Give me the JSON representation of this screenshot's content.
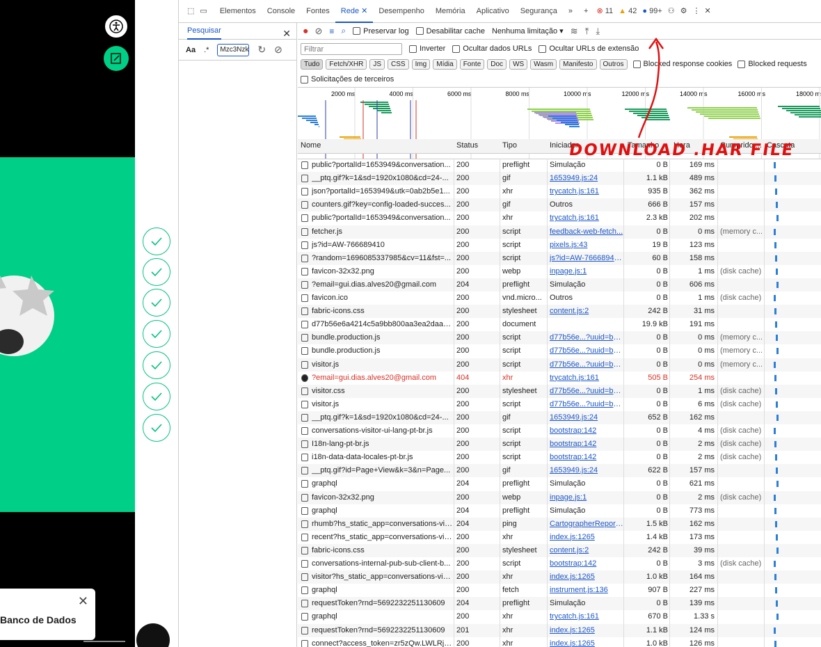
{
  "website": {
    "toast_text": "Banco de Dados"
  },
  "devtools": {
    "tabs": [
      "Elementos",
      "Console",
      "Fontes",
      "Rede",
      "Desempenho",
      "Memória",
      "Aplicativo",
      "Segurança"
    ],
    "badges": {
      "errors": "11",
      "warnings": "42",
      "info": "99+"
    },
    "search_panel": {
      "title": "Pesquisar",
      "case_label": "Aa",
      "regex_label": ".*",
      "query": "Mzc3Nzk"
    },
    "network_toolbar": {
      "preserve_log": "Preservar log",
      "disable_cache": "Desabilitar cache",
      "throttle": "Nenhuma limitação"
    },
    "filter": {
      "placeholder": "Filtrar",
      "invert": "Inverter",
      "hide_data_urls": "Ocultar dados URLs",
      "hide_ext_urls": "Ocultar URLs de extensão"
    },
    "type_filters": [
      "Tudo",
      "Fetch/XHR",
      "JS",
      "CSS",
      "Img",
      "Mídia",
      "Fonte",
      "Doc",
      "WS",
      "Wasm",
      "Manifesto",
      "Outros"
    ],
    "blocked_cookies": "Blocked response cookies",
    "blocked_requests": "Blocked requests",
    "third_party": "Solicitações de terceiros",
    "timeline_ticks": [
      "2000 ms",
      "4000 ms",
      "6000 ms",
      "8000 ms",
      "10000 ms",
      "12000 ms",
      "14000 ms",
      "16000 ms",
      "18000 ms"
    ],
    "columns": [
      "Nome",
      "Status",
      "Tipo",
      "Iniciador",
      "Tamanho",
      "Hora",
      "Cumprido ...",
      "Cascata"
    ],
    "rows": [
      {
        "name": "public?portalId=1653949&conversation...",
        "status": "200",
        "type": "preflight",
        "initiator": "Simulação",
        "size": "0 B",
        "time": "169 ms",
        "fulfilled": ""
      },
      {
        "name": "__ptq.gif?k=1&sd=1920x1080&cd=24-...",
        "status": "200",
        "type": "gif",
        "initiator": "1653949.js:24",
        "size": "1.1 kB",
        "time": "489 ms",
        "fulfilled": ""
      },
      {
        "name": "json?portalId=1653949&utk=0ab2b5e1...",
        "status": "200",
        "type": "xhr",
        "initiator": "trycatch.js:161",
        "size": "935 B",
        "time": "362 ms",
        "fulfilled": ""
      },
      {
        "name": "counters.gif?key=config-loaded-succes...",
        "status": "200",
        "type": "gif",
        "initiator": "Outros",
        "size": "666 B",
        "time": "157 ms",
        "fulfilled": ""
      },
      {
        "name": "public?portalId=1653949&conversation...",
        "status": "200",
        "type": "xhr",
        "initiator": "trycatch.js:161",
        "size": "2.3 kB",
        "time": "202 ms",
        "fulfilled": ""
      },
      {
        "name": "fetcher.js",
        "status": "200",
        "type": "script",
        "initiator": "feedback-web-fetch...",
        "size": "0 B",
        "time": "0 ms",
        "fulfilled": "(memory c..."
      },
      {
        "name": "js?id=AW-766689410",
        "status": "200",
        "type": "script",
        "initiator": "pixels.js:43",
        "size": "19 B",
        "time": "123 ms",
        "fulfilled": ""
      },
      {
        "name": "?random=1696085337985&cv=11&fst=...",
        "status": "200",
        "type": "script",
        "initiator": "js?id=AW-76668941...",
        "size": "60 B",
        "time": "158 ms",
        "fulfilled": ""
      },
      {
        "name": "favicon-32x32.png",
        "status": "200",
        "type": "webp",
        "initiator": "inpage.js:1",
        "size": "0 B",
        "time": "1 ms",
        "fulfilled": "(disk cache)"
      },
      {
        "name": "?email=gui.dias.alves20@gmail.com",
        "status": "204",
        "type": "preflight",
        "initiator": "Simulação",
        "size": "0 B",
        "time": "606 ms",
        "fulfilled": ""
      },
      {
        "name": "favicon.ico",
        "status": "200",
        "type": "vnd.micro...",
        "initiator": "Outros",
        "size": "0 B",
        "time": "1 ms",
        "fulfilled": "(disk cache)"
      },
      {
        "name": "fabric-icons.css",
        "status": "200",
        "type": "stylesheet",
        "initiator": "content.js:2",
        "size": "242 B",
        "time": "31 ms",
        "fulfilled": ""
      },
      {
        "name": "d77b56e6a4214c5a9bb800aa3ea2daa6?...",
        "status": "200",
        "type": "document",
        "initiator": "",
        "size": "19.9 kB",
        "time": "191 ms",
        "fulfilled": ""
      },
      {
        "name": "bundle.production.js",
        "status": "200",
        "type": "script",
        "initiator": "d77b56e...?uuid=b7...",
        "size": "0 B",
        "time": "0 ms",
        "fulfilled": "(memory c..."
      },
      {
        "name": "bundle.production.js",
        "status": "200",
        "type": "script",
        "initiator": "d77b56e...?uuid=b7...",
        "size": "0 B",
        "time": "0 ms",
        "fulfilled": "(memory c..."
      },
      {
        "name": "visitor.js",
        "status": "200",
        "type": "script",
        "initiator": "d77b56e...?uuid=b7...",
        "size": "0 B",
        "time": "0 ms",
        "fulfilled": "(memory c..."
      },
      {
        "name": "?email=gui.dias.alves20@gmail.com",
        "status": "404",
        "type": "xhr",
        "initiator": "trycatch.js:161",
        "size": "505 B",
        "time": "254 ms",
        "fulfilled": "",
        "error": true
      },
      {
        "name": "visitor.css",
        "status": "200",
        "type": "stylesheet",
        "initiator": "d77b56e...?uuid=b7...",
        "size": "0 B",
        "time": "1 ms",
        "fulfilled": "(disk cache)"
      },
      {
        "name": "visitor.js",
        "status": "200",
        "type": "script",
        "initiator": "d77b56e...?uuid=b7...",
        "size": "0 B",
        "time": "6 ms",
        "fulfilled": "(disk cache)"
      },
      {
        "name": "__ptq.gif?k=1&sd=1920x1080&cd=24-...",
        "status": "200",
        "type": "gif",
        "initiator": "1653949.js:24",
        "size": "652 B",
        "time": "162 ms",
        "fulfilled": ""
      },
      {
        "name": "conversations-visitor-ui-lang-pt-br.js",
        "status": "200",
        "type": "script",
        "initiator": "bootstrap:142",
        "size": "0 B",
        "time": "4 ms",
        "fulfilled": "(disk cache)"
      },
      {
        "name": "I18n-lang-pt-br.js",
        "status": "200",
        "type": "script",
        "initiator": "bootstrap:142",
        "size": "0 B",
        "time": "2 ms",
        "fulfilled": "(disk cache)"
      },
      {
        "name": "i18n-data-data-locales-pt-br.js",
        "status": "200",
        "type": "script",
        "initiator": "bootstrap:142",
        "size": "0 B",
        "time": "2 ms",
        "fulfilled": "(disk cache)"
      },
      {
        "name": "__ptq.gif?id=Page+View&k=3&n=Page...",
        "status": "200",
        "type": "gif",
        "initiator": "1653949.js:24",
        "size": "622 B",
        "time": "157 ms",
        "fulfilled": ""
      },
      {
        "name": "graphql",
        "status": "204",
        "type": "preflight",
        "initiator": "Simulação",
        "size": "0 B",
        "time": "621 ms",
        "fulfilled": ""
      },
      {
        "name": "favicon-32x32.png",
        "status": "200",
        "type": "webp",
        "initiator": "inpage.js:1",
        "size": "0 B",
        "time": "2 ms",
        "fulfilled": "(disk cache)"
      },
      {
        "name": "graphql",
        "status": "204",
        "type": "preflight",
        "initiator": "Simulação",
        "size": "0 B",
        "time": "773 ms",
        "fulfilled": ""
      },
      {
        "name": "rhumb?hs_static_app=conversations-visi...",
        "status": "204",
        "type": "ping",
        "initiator": "CartographerReport...",
        "size": "1.5 kB",
        "time": "162 ms",
        "fulfilled": ""
      },
      {
        "name": "recent?hs_static_app=conversations-visi...",
        "status": "200",
        "type": "xhr",
        "initiator": "index.js:1265",
        "size": "1.4 kB",
        "time": "173 ms",
        "fulfilled": ""
      },
      {
        "name": "fabric-icons.css",
        "status": "200",
        "type": "stylesheet",
        "initiator": "content.js:2",
        "size": "242 B",
        "time": "39 ms",
        "fulfilled": ""
      },
      {
        "name": "conversations-internal-pub-sub-client-b...",
        "status": "200",
        "type": "script",
        "initiator": "bootstrap:142",
        "size": "0 B",
        "time": "3 ms",
        "fulfilled": "(disk cache)"
      },
      {
        "name": "visitor?hs_static_app=conversations-visi...",
        "status": "200",
        "type": "xhr",
        "initiator": "index.js:1265",
        "size": "1.0 kB",
        "time": "164 ms",
        "fulfilled": ""
      },
      {
        "name": "graphql",
        "status": "200",
        "type": "fetch",
        "initiator": "instrument.js:136",
        "size": "907 B",
        "time": "227 ms",
        "fulfilled": ""
      },
      {
        "name": "requestToken?rnd=5692232251130609",
        "status": "204",
        "type": "preflight",
        "initiator": "Simulação",
        "size": "0 B",
        "time": "139 ms",
        "fulfilled": ""
      },
      {
        "name": "graphql",
        "status": "200",
        "type": "xhr",
        "initiator": "trycatch.js:161",
        "size": "670 B",
        "time": "1.33 s",
        "fulfilled": ""
      },
      {
        "name": "requestToken?rnd=5692232251130609",
        "status": "201",
        "type": "xhr",
        "initiator": "index.js:1265",
        "size": "1.1 kB",
        "time": "124 ms",
        "fulfilled": ""
      },
      {
        "name": "connect?access_token=zr5zQw.LWLRjH...",
        "status": "200",
        "type": "xhr",
        "initiator": "index.js:1265",
        "size": "1.0 kB",
        "time": "126 ms",
        "fulfilled": ""
      }
    ]
  },
  "annotation": "DOWNLOAD .HAR FILE",
  "colors": {
    "accent": "#1a56c6",
    "green": "#00cf87",
    "error": "#d93025",
    "annotation": "#e01010"
  }
}
